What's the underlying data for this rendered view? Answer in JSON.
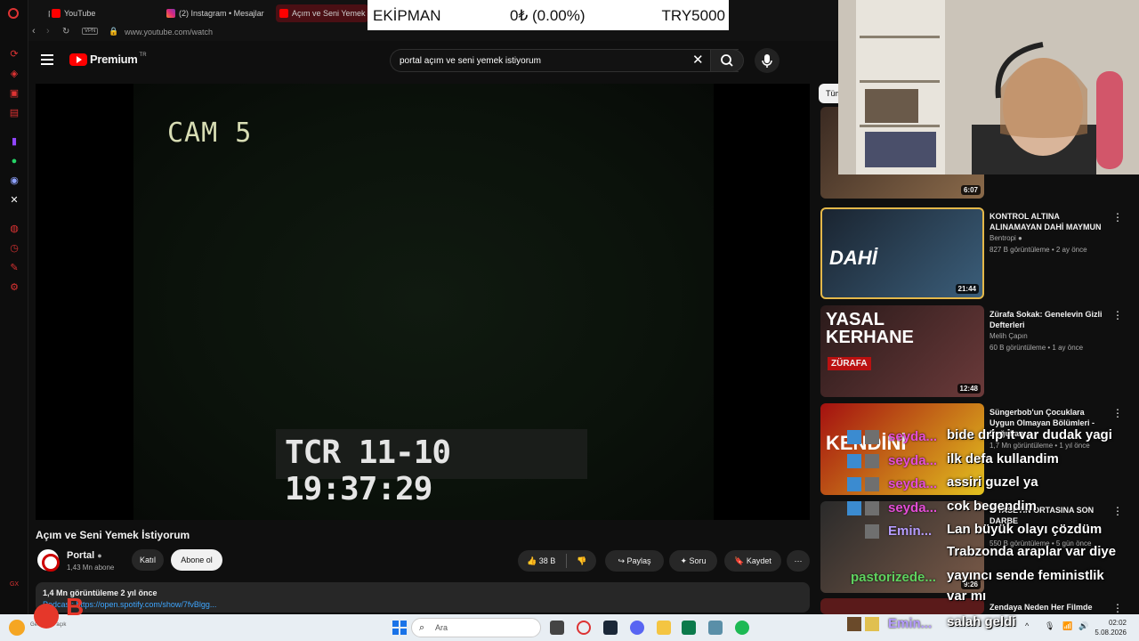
{
  "browser": {
    "tabs": [
      {
        "label": "YouTube"
      },
      {
        "label": "(2) Instagram • Mesajlar"
      },
      {
        "label": "Açım ve Seni Yemek İs"
      }
    ],
    "url": "www.youtube.com/watch",
    "vpn_label": "VPN"
  },
  "header": {
    "logo_text": "Premium",
    "logo_region": "TR",
    "search_value": "portal açım ve seni yemek istiyorum"
  },
  "player": {
    "cam_label": "CAM 5",
    "timecode": "TCR 11-10 19:37:29"
  },
  "video": {
    "title": "Açım ve Seni Yemek İstiyorum",
    "channel": "Portal",
    "subscribers": "1,43 Mn abone",
    "join_label": "Katıl",
    "subscribe_label": "Abone ol",
    "likes": "38 B",
    "share_label": "Paylaş",
    "ask_label": "Soru",
    "save_label": "Kaydet",
    "views_date": "1,4 Mn görüntüleme  2 yıl önce",
    "desc_link": "Podcast: https://open.spotify.com/show/7fvBlgg..."
  },
  "filter_chip": "Tümü",
  "recommendations": [
    {
      "title": "",
      "channel": "",
      "views": "",
      "duration": "6:07"
    },
    {
      "title": "KONTROL ALTINA ALINAMAYAN DAHİ MAYMUN",
      "channel": "Bentropi",
      "views": "827 B görüntüleme • 2 ay önce",
      "duration": "21:44",
      "thumb_text": "DAHİ"
    },
    {
      "title": "Zürafa Sokak: Genelevin Gizli Defterleri",
      "channel": "Melih Çapın",
      "views": "60 B görüntüleme • 1 ay önce",
      "duration": "12:48",
      "thumb_text": "YASAL KERHANE",
      "thumb_sub": "ZÜRAFA"
    },
    {
      "title": "Süngerbob'un Çocuklara Uygun Olmayan Bölümleri - Doğukan...",
      "channel": "",
      "views": "1,7 Mn görüntüleme • 1 yıl önce",
      "duration": "",
      "thumb_text": "KENDİNİ"
    },
    {
      "title": "SİYASETİN ORTASINA SON DARBE",
      "channel": "",
      "views": "550 B görüntüleme • 5 gün önce",
      "duration": "9:26"
    },
    {
      "title": "Zendaya Neden Her Filmde",
      "channel": "",
      "views": "",
      "duration": ""
    }
  ],
  "overlay": {
    "score_left": "EKİPMAN",
    "score_mid": "0₺ (0.00%)",
    "score_right": "TRY5000"
  },
  "chat": [
    {
      "user": "seyda...",
      "msg": "bide drip it var dudak yagi"
    },
    {
      "user": "seyda...",
      "msg": "ilk defa kullandim"
    },
    {
      "user": "seyda...",
      "msg": "assiri guzel ya"
    },
    {
      "user": "seyda...",
      "msg": "cok begendim"
    },
    {
      "user": "Emin...",
      "msg": "Lan büyük olayı çözdüm"
    },
    {
      "user": "",
      "msg": "Trabzonda araplar var diye"
    },
    {
      "user": "pastorizede...",
      "msg": "yayıncı sende feministlik"
    },
    {
      "user": "",
      "msg": "var mı"
    },
    {
      "user": "Emin...",
      "msg": "salah geldi"
    }
  ],
  "taskbar": {
    "search_placeholder": "Ara",
    "time": "02:02",
    "date": "5.08.2026",
    "weather_label": "Gece 1 de açık"
  },
  "colors": {
    "accent": "#ff0000",
    "chat_user": "#e54dd8",
    "link": "#3ea6ff"
  }
}
